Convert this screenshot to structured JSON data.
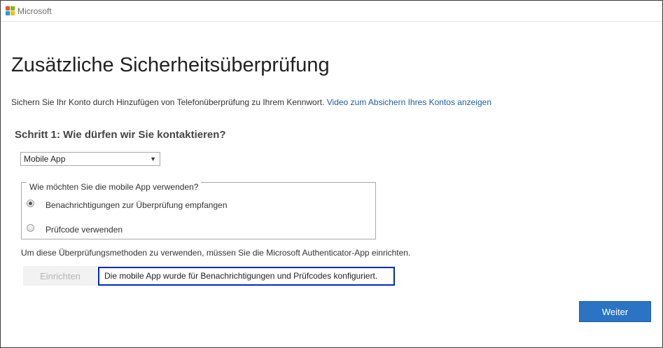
{
  "header": {
    "brand": "Microsoft",
    "logo_icon": "microsoft-logo-icon",
    "logo_colors": [
      "#f25022",
      "#7fba00",
      "#00a4ef",
      "#ffb900"
    ]
  },
  "page": {
    "title": "Zusätzliche Sicherheitsüberprüfung",
    "intro_text": "Sichern Sie Ihr Konto durch Hinzufügen von Telefonüberprüfung zu Ihrem Kennwort.",
    "intro_link": "Video zum Absichern Ihres Kontos anzeigen"
  },
  "step1": {
    "heading": "Schritt 1: Wie dürfen wir Sie kontaktieren?",
    "method_select": {
      "selected": "Mobile App",
      "arrow_icon": "dropdown-triangle-icon"
    },
    "usage_group": {
      "legend": "Wie möchten Sie die mobile App verwenden?",
      "options": [
        {
          "label": "Benachrichtigungen zur Überprüfung empfangen",
          "checked": true
        },
        {
          "label": "Prüfcode verwenden",
          "checked": false
        }
      ]
    },
    "note": "Um diese Überprüfungsmethoden zu verwenden, müssen Sie die Microsoft Authenticator-App einrichten.",
    "setup_button": "Einrichten",
    "status_message": "Die mobile App wurde für Benachrichtigungen und Prüfcodes konfiguriert."
  },
  "footer": {
    "next_button": "Weiter"
  },
  "colors": {
    "accent": "#2b74c4",
    "link": "#1f5fa8",
    "status_border": "#0028c8"
  }
}
